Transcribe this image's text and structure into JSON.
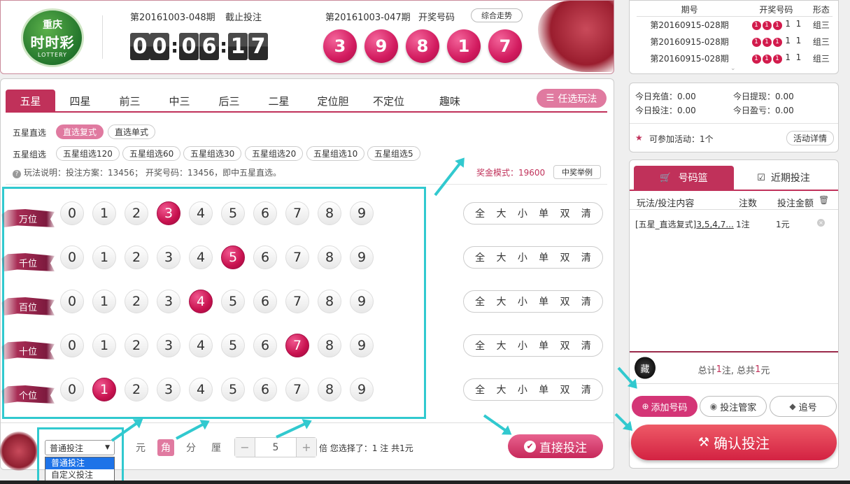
{
  "header": {
    "logo": {
      "line1": "重庆",
      "line2": "时时彩",
      "line3": "LOTTERY"
    },
    "current_period": "第20161003-048期",
    "deadline_label": "截止投注",
    "countdown": [
      "0",
      "0",
      "0",
      "6",
      "1",
      "7"
    ],
    "last_period": "第20161003-047期",
    "draw_label": "开奖号码",
    "draw_numbers": [
      "3",
      "9",
      "8",
      "1",
      "7"
    ],
    "trend_button": "综合走势"
  },
  "history": {
    "headers": [
      "期号",
      "开奖号码",
      "形态"
    ],
    "rows": [
      {
        "period": "第20160915-028期",
        "balls": [
          "1",
          "1",
          "1"
        ],
        "plain": [
          "1",
          "1"
        ],
        "shape": "组三"
      },
      {
        "period": "第20160915-028期",
        "balls": [
          "1",
          "1",
          "1"
        ],
        "plain": [
          "1",
          "1"
        ],
        "shape": "组三"
      },
      {
        "period": "第20160915-028期",
        "balls": [
          "1",
          "1",
          "1"
        ],
        "plain": [
          "1",
          "1"
        ],
        "shape": "组三"
      }
    ]
  },
  "account": {
    "recharge": "今日充值：0.00",
    "withdraw": "今日提现：0.00",
    "bet": "今日投注：0.00",
    "profit": "今日盈亏：0.00",
    "activity": "可参加活动：1个",
    "activity_button": "活动详情"
  },
  "tabs": [
    "五星",
    "四星",
    "前三",
    "中三",
    "后三",
    "二星",
    "定位胆",
    "不定位",
    "趣味"
  ],
  "pick_button": "任选玩法",
  "direct_row": {
    "label": "五星直选",
    "options": [
      "直选复式",
      "直选单式"
    ]
  },
  "group_row": {
    "label": "五星组选",
    "options": [
      "五星组选120",
      "五星组选60",
      "五星组选30",
      "五星组选20",
      "五星组选10",
      "五星组选5"
    ]
  },
  "help_text": "玩法说明：投注方案：13456； 开奖号码：13456，即中五星直选。",
  "prize_mode": "奖金模式：19600",
  "example_button": "中奖举例",
  "positions": [
    {
      "label": "万位",
      "selected": 3
    },
    {
      "label": "千位",
      "selected": 5
    },
    {
      "label": "百位",
      "selected": 4
    },
    {
      "label": "十位",
      "selected": 7
    },
    {
      "label": "个位",
      "selected": 1
    }
  ],
  "digits": [
    "0",
    "1",
    "2",
    "3",
    "4",
    "5",
    "6",
    "7",
    "8",
    "9"
  ],
  "quick": [
    "全",
    "大",
    "小",
    "单",
    "双",
    "清"
  ],
  "bottom": {
    "mode_selected": "普通投注",
    "mode_options": [
      "普通投注",
      "自定义投注"
    ],
    "units": [
      "元",
      "角",
      "分",
      "厘"
    ],
    "unit_selected": "角",
    "multiplier": "5",
    "multiplier_suffix": "倍",
    "summary": "您选择了：1 注 共1元",
    "direct_button": "直接投注"
  },
  "basket": {
    "tab_basket": "号码篮",
    "tab_recent": "近期投注",
    "col_content": "玩法/投注内容",
    "col_count": "注数",
    "col_amount": "投注金额",
    "item_play": "[五星_直选复式]",
    "item_numbers": "3,5,4,7...",
    "item_count": "1注",
    "item_amount": "1元",
    "collect_char": "藏",
    "total_prefix": "总计",
    "total_count": "1",
    "total_mid": "注, 总共",
    "total_amount": "1",
    "total_suffix": "元",
    "add_button": "添加号码",
    "manager_button": "投注管家",
    "chase_button": "追号",
    "confirm_button": "确认投注"
  },
  "colors": {
    "brand": "#c0315a",
    "highlight": "#31c9cf",
    "ball": "#d21b5f"
  }
}
